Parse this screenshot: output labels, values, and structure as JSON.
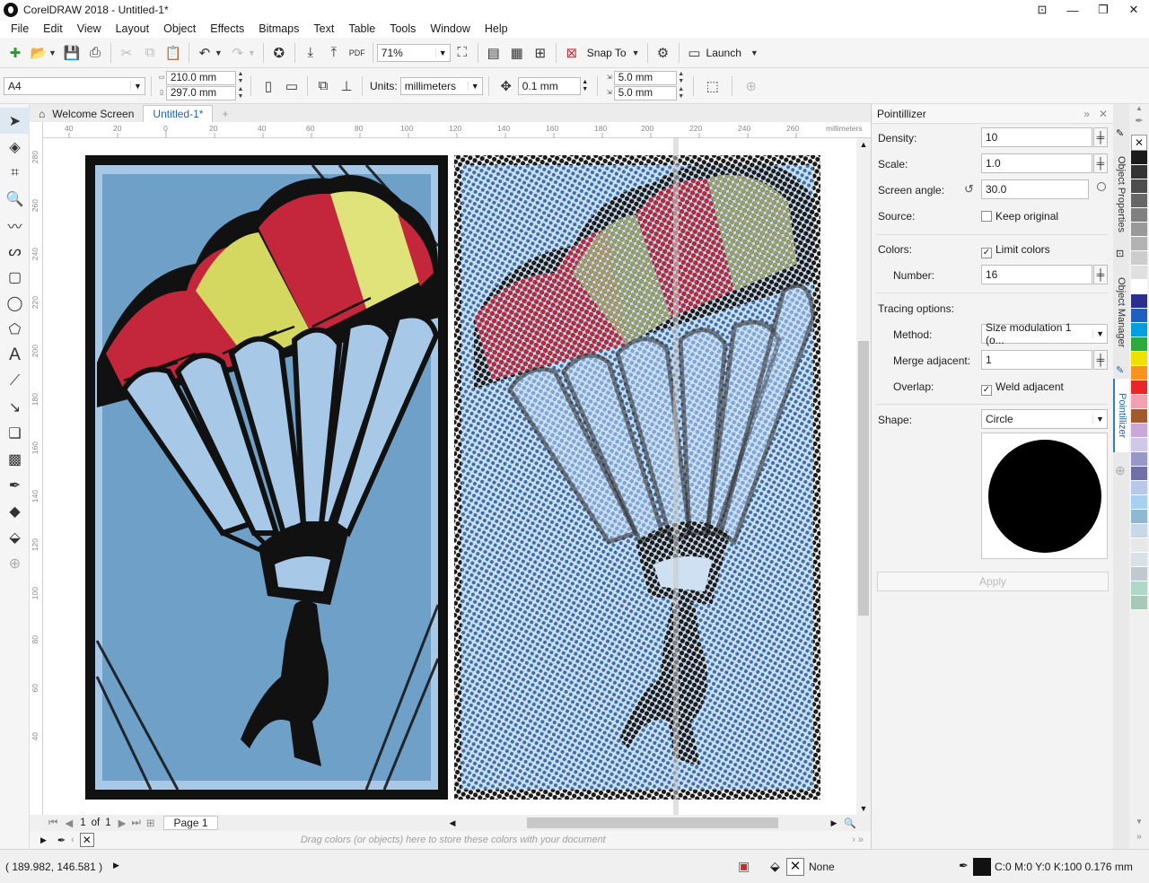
{
  "window": {
    "title": "CorelDRAW 2018 - Untitled-1*"
  },
  "menu": [
    "File",
    "Edit",
    "View",
    "Layout",
    "Object",
    "Effects",
    "Bitmaps",
    "Text",
    "Table",
    "Tools",
    "Window",
    "Help"
  ],
  "toolbar": {
    "zoom": "71%",
    "snap_label": "Snap To",
    "launch_label": "Launch"
  },
  "property_bar": {
    "page_size": "A4",
    "width": "210.0 mm",
    "height": "297.0 mm",
    "units_label": "Units:",
    "units": "millimeters",
    "nudge": "0.1 mm",
    "dup_x": "5.0 mm",
    "dup_y": "5.0 mm"
  },
  "tabs": [
    "Welcome Screen",
    "Untitled-1*"
  ],
  "ruler": {
    "h_labels": [
      "40",
      "20",
      "0",
      "20",
      "40",
      "60",
      "80",
      "100",
      "120",
      "140",
      "160",
      "180",
      "200",
      "220",
      "240",
      "260"
    ],
    "units_label": "millimeters",
    "v_labels": [
      "280",
      "260",
      "240",
      "220",
      "200",
      "180",
      "160",
      "140",
      "120",
      "100",
      "80",
      "60",
      "40"
    ]
  },
  "page_nav": {
    "current": "1",
    "of_label": "of",
    "total": "1",
    "page_tab": "Page 1"
  },
  "palette_hint": "Drag colors (or objects) here to store these colors with your document",
  "docker": {
    "title": "Pointillizer",
    "density_label": "Density:",
    "density": "10",
    "scale_label": "Scale:",
    "scale": "1.0",
    "angle_label": "Screen angle:",
    "angle": "30.0",
    "source_label": "Source:",
    "keep_original": "Keep original",
    "colors_label": "Colors:",
    "limit_colors": "Limit colors",
    "number_label": "Number:",
    "number": "16",
    "tracing_label": "Tracing options:",
    "method_label": "Method:",
    "method": "Size modulation 1 (o...",
    "merge_label": "Merge adjacent:",
    "merge": "1",
    "overlap_label": "Overlap:",
    "weld": "Weld adjacent",
    "shape_label": "Shape:",
    "shape": "Circle",
    "apply": "Apply"
  },
  "side_tabs": [
    "Object Properties",
    "Object Manager",
    "Pointillizer"
  ],
  "palette_colors": [
    "#1a1a1a",
    "#333333",
    "#4d4d4d",
    "#666666",
    "#808080",
    "#999999",
    "#b3b3b3",
    "#cccccc",
    "#e0e0e0",
    "#ffffff",
    "#2a2f8f",
    "#1f5fbf",
    "#00a0e0",
    "#2eaa3c",
    "#f0e000",
    "#f7941d",
    "#e8252a",
    "#f5a0b0",
    "#a05a2c",
    "#c8a8d8",
    "#d0c8e8",
    "#9898c8",
    "#7070a8",
    "#b8c8e8",
    "#a8d0f0",
    "#90b8d0",
    "#c8d8e8",
    "#e8e8e8",
    "#d8e0e8",
    "#c0c8d0",
    "#b0d8c8",
    "#a8c8b8"
  ],
  "status": {
    "coords": "( 189.982, 146.581 )",
    "fill": "None",
    "outline": "C:0 M:0 Y:0 K:100  0.176 mm"
  }
}
